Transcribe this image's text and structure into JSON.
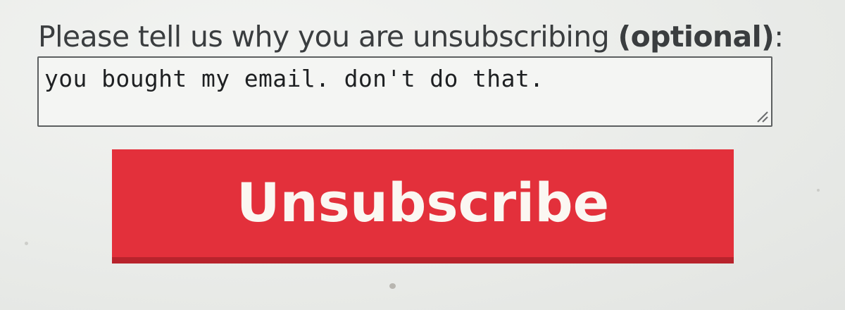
{
  "form": {
    "prompt_text": "Please tell us why you are unsubscribing ",
    "prompt_optional": "(optional)",
    "prompt_colon": ":",
    "reason_value": "you bought my email. don't do that.",
    "submit_label": "Unsubscribe"
  },
  "colors": {
    "button_red": "#e3303b",
    "button_shadow": "#b8232c",
    "button_text": "#fbf7f2",
    "page_background": "#eceeec",
    "label_text": "#3a3d3f"
  },
  "icons": {
    "textarea_resize": "resize-grip-icon"
  }
}
